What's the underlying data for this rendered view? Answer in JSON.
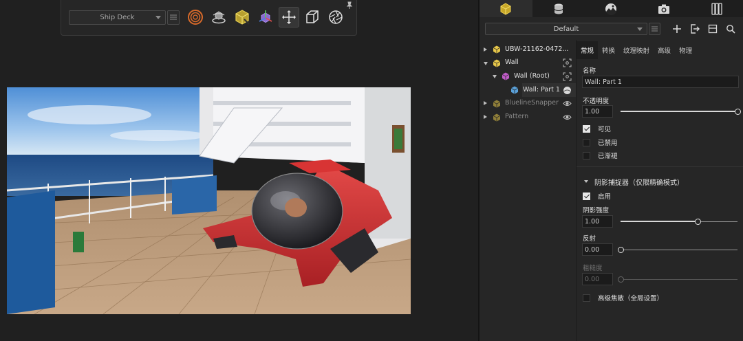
{
  "toolbar": {
    "scene_select": "Ship Deck",
    "tools": [
      {
        "name": "target-icon"
      },
      {
        "name": "turntable-icon"
      },
      {
        "name": "model-cube-icon"
      },
      {
        "name": "gizmo-axis-icon"
      },
      {
        "name": "move-icon",
        "active": true
      },
      {
        "name": "box-outline-icon"
      },
      {
        "name": "aperture-icon"
      }
    ]
  },
  "panel": {
    "top_tabs": [
      "models-icon",
      "materials-icon",
      "environment-icon",
      "camera-icon",
      "toolkit-icon"
    ],
    "preset_select": "Default",
    "row_icons": [
      "add-icon",
      "export-icon",
      "layout-icon",
      "search-icon"
    ]
  },
  "tree": {
    "items": [
      {
        "label": "UBW-21162-0472...",
        "expanded": false,
        "level": 0,
        "dim": false,
        "color": "#e8c84a"
      },
      {
        "label": "Wall",
        "expanded": true,
        "level": 0,
        "dim": false,
        "color": "#e8c84a",
        "side": "target-icon"
      },
      {
        "label": "Wall (Root)",
        "expanded": true,
        "level": 1,
        "dim": false,
        "color": "#c05cc8",
        "side": "target-icon"
      },
      {
        "label": "Wall: Part 1",
        "expanded": null,
        "level": 2,
        "dim": false,
        "color": "#5aa0d8",
        "selected": true,
        "side": "material-ball-icon"
      },
      {
        "label": "BluelineSnapper",
        "expanded": false,
        "level": 0,
        "dim": true,
        "color": "#e8c84a",
        "side": "eye-icon"
      },
      {
        "label": "Pattern",
        "expanded": false,
        "level": 0,
        "dim": true,
        "color": "#e8c84a",
        "side": "eye-icon"
      }
    ]
  },
  "props": {
    "tabs": [
      "常规",
      "转换",
      "纹理映射",
      "高级",
      "物理"
    ],
    "active_tab": "常规",
    "name_label": "名称",
    "name_value": "Wall: Part 1",
    "opacity_label": "不透明度",
    "opacity_value": "1.00",
    "opacity_level": 1.0,
    "visible_label": "可见",
    "visible_checked": true,
    "disabled_label": "已禁用",
    "disabled_checked": false,
    "faded_label": "已渐褪",
    "faded_checked": false,
    "shadow_section_label": "阴影捕捉器（仅限精确模式）",
    "enable_label": "启用",
    "enable_checked": true,
    "shadow_strength_label": "阴影强度",
    "shadow_strength_value": "1.00",
    "shadow_strength_level": 0.66,
    "reflection_label": "反射",
    "reflection_value": "0.00",
    "reflection_level": 0.0,
    "roughness_label": "粗糙度",
    "roughness_value": "0.00",
    "roughness_level": 0.0,
    "caustics_label": "高级焦散（全局设置）",
    "caustics_checked": false
  }
}
